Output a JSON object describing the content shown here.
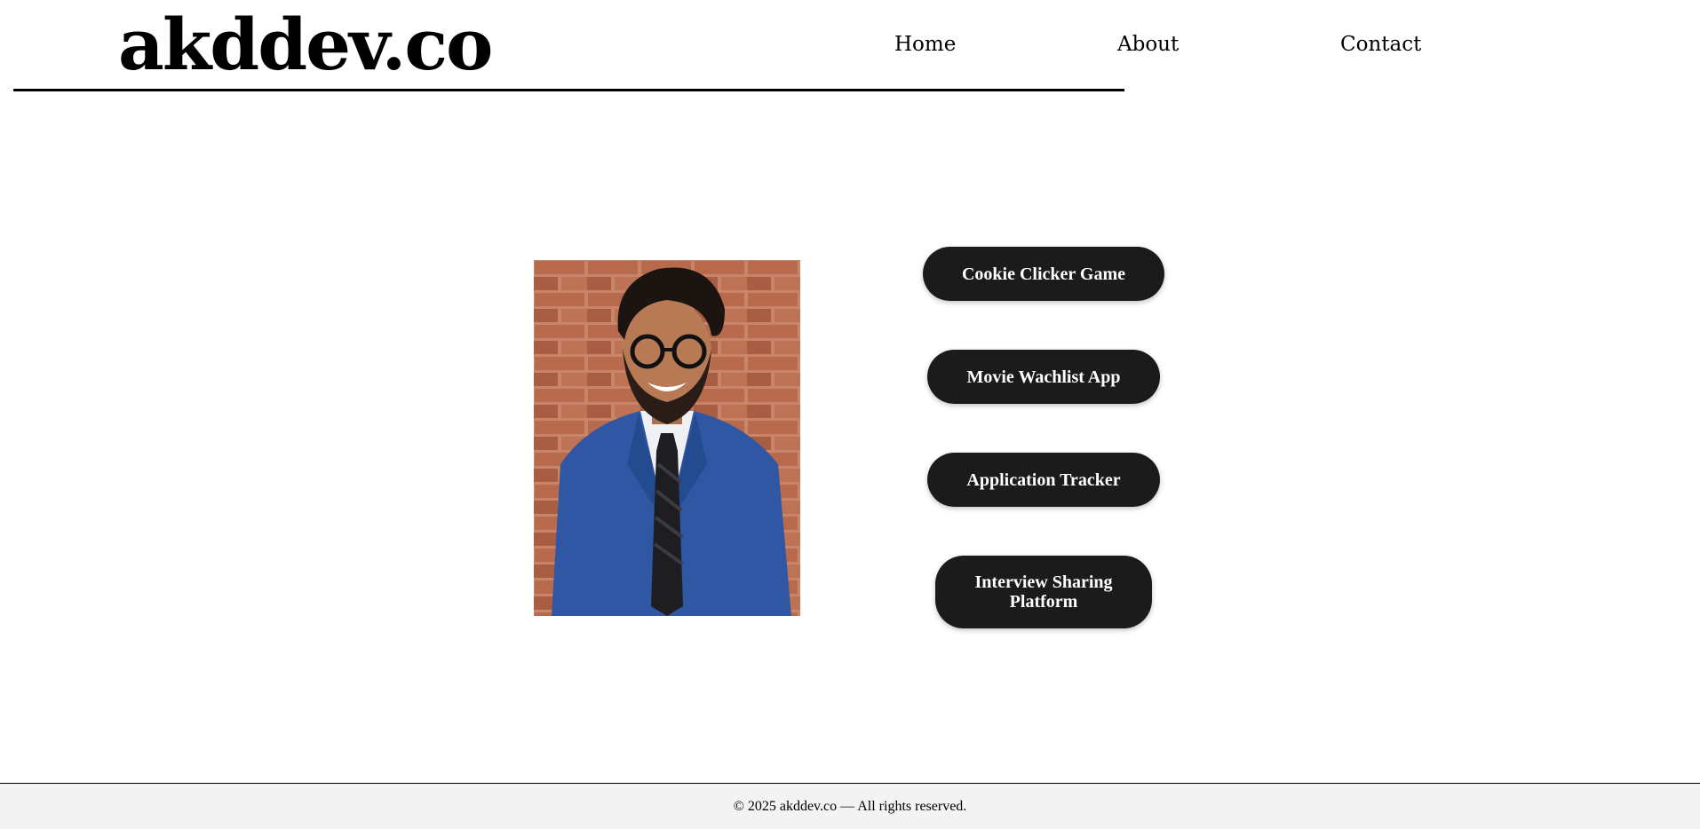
{
  "header": {
    "logo": "akddev.co",
    "nav": {
      "home": "Home",
      "about": "About",
      "contact": "Contact"
    }
  },
  "main": {
    "portrait_alt": "Portrait photo",
    "projects": [
      "Cookie Clicker Game",
      "Movie Wachlist App",
      "Application Tracker",
      "Interview Sharing Platform"
    ]
  },
  "footer": {
    "text": "© 2025 akddev.co — All rights reserved."
  },
  "colors": {
    "button_bg": "#1b1b1b",
    "button_text": "#ffffff",
    "footer_bg": "#f3f3f3"
  }
}
